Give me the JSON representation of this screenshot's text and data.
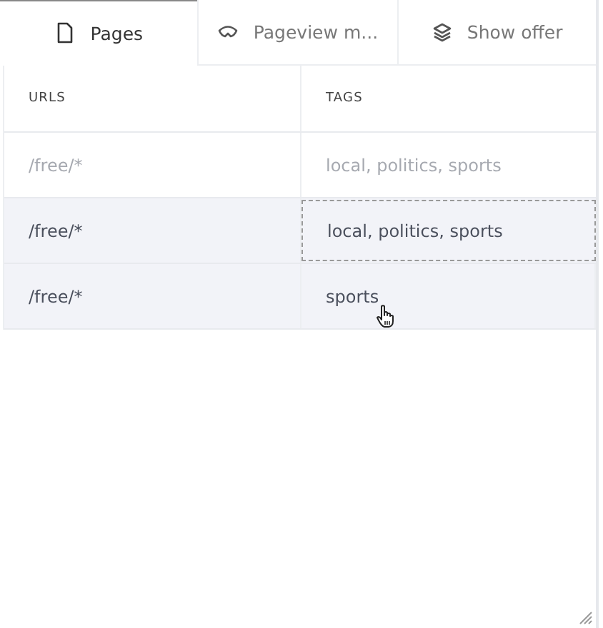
{
  "tabs": [
    {
      "label": "Pages",
      "kind": "page",
      "selected": true
    },
    {
      "label": "Pageview m...",
      "kind": "eye",
      "selected": false
    },
    {
      "label": "Show offer",
      "kind": "layers",
      "selected": false
    }
  ],
  "table": {
    "columns": [
      "URLS",
      "TAGS"
    ],
    "rows": [
      {
        "url": "/free/*",
        "tags": "local, politics, sports",
        "dimmed": true,
        "selected": false,
        "focused": false
      },
      {
        "url": "/free/*",
        "tags": "local, politics, sports",
        "dimmed": false,
        "selected": true,
        "focused": true
      },
      {
        "url": "/free/*",
        "tags": "sports",
        "dimmed": false,
        "selected": true,
        "focused": false
      }
    ]
  }
}
